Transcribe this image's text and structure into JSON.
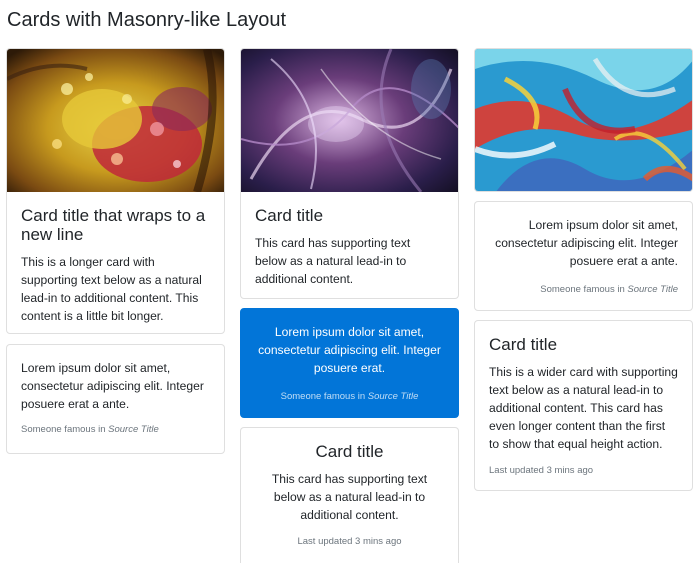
{
  "page": {
    "title": "Cards with Masonry-like Layout"
  },
  "cards": {
    "c1": {
      "image_alt": "Amber glass with colorful bubbles",
      "title": "Card title that wraps to a new line",
      "text": "This is a longer card with supporting text below as a natural lead-in to additional content. This content is a little bit longer."
    },
    "c2": {
      "quote": "Lorem ipsum dolor sit amet, consectetur adipiscing elit. Integer posuere erat a ante.",
      "footer_prefix": "Someone famous in ",
      "footer_source": "Source Title"
    },
    "c3": {
      "image_alt": "Purple abstract swirl",
      "title": "Card title",
      "text": "This card has supporting text below as a natural lead-in to additional content."
    },
    "c4": {
      "quote": "Lorem ipsum dolor sit amet, consectetur adipiscing elit. Integer posuere erat.",
      "footer_prefix": "Someone famous in ",
      "footer_source": "Source Title"
    },
    "c5": {
      "title": "Card title",
      "text": "This card has supporting text below as a natural lead-in to additional content.",
      "muted": "Last updated 3 mins ago"
    },
    "c6": {
      "image_alt": "Colorful paint strokes",
      "quote": "Lorem ipsum dolor sit amet, consectetur adipiscing elit. Integer posuere erat a ante.",
      "footer_prefix": "Someone famous in ",
      "footer_source": "Source Title"
    },
    "c7": {
      "title": "Card title",
      "text": "This is a wider card with supporting text below as a natural lead-in to additional content. This card has even longer content than the first to show that equal height action.",
      "muted": "Last updated 3 mins ago"
    }
  },
  "colors": {
    "primary": "#0275d8",
    "muted": "#6c757d",
    "border": "rgba(0,0,0,0.125)"
  }
}
